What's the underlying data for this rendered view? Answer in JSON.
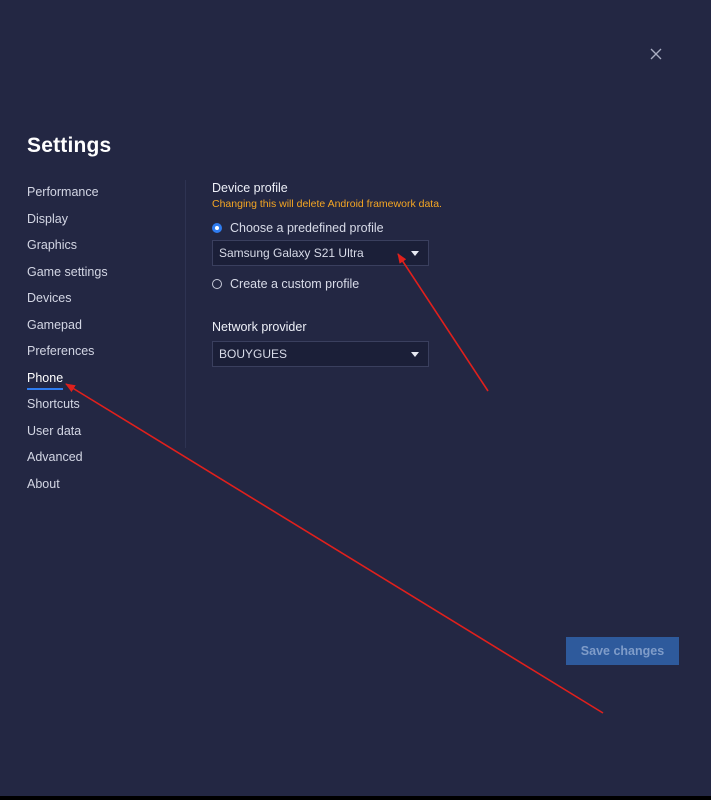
{
  "title": "Settings",
  "sidebar": {
    "items": [
      {
        "label": "Performance"
      },
      {
        "label": "Display"
      },
      {
        "label": "Graphics"
      },
      {
        "label": "Game settings"
      },
      {
        "label": "Devices"
      },
      {
        "label": "Gamepad"
      },
      {
        "label": "Preferences"
      },
      {
        "label": "Phone",
        "active": true
      },
      {
        "label": "Shortcuts"
      },
      {
        "label": "User data"
      },
      {
        "label": "Advanced"
      },
      {
        "label": "About"
      }
    ]
  },
  "device_profile": {
    "title": "Device profile",
    "warning": "Changing this will delete Android framework data.",
    "predefined_option": "Choose a predefined profile",
    "predefined_selected": true,
    "selected_profile": "Samsung Galaxy S21 Ultra",
    "custom_option": "Create a custom profile"
  },
  "network": {
    "title": "Network provider",
    "selected": "BOUYGUES"
  },
  "buttons": {
    "save": "Save changes"
  },
  "icons": {
    "close": "close-icon",
    "dropdown": "caret-down-icon"
  },
  "colors": {
    "background": "#232743",
    "accent": "#2f7cf0",
    "warning": "#f5a623",
    "annotation_arrow": "#e0201c",
    "save_button": "#2e5a9c"
  }
}
